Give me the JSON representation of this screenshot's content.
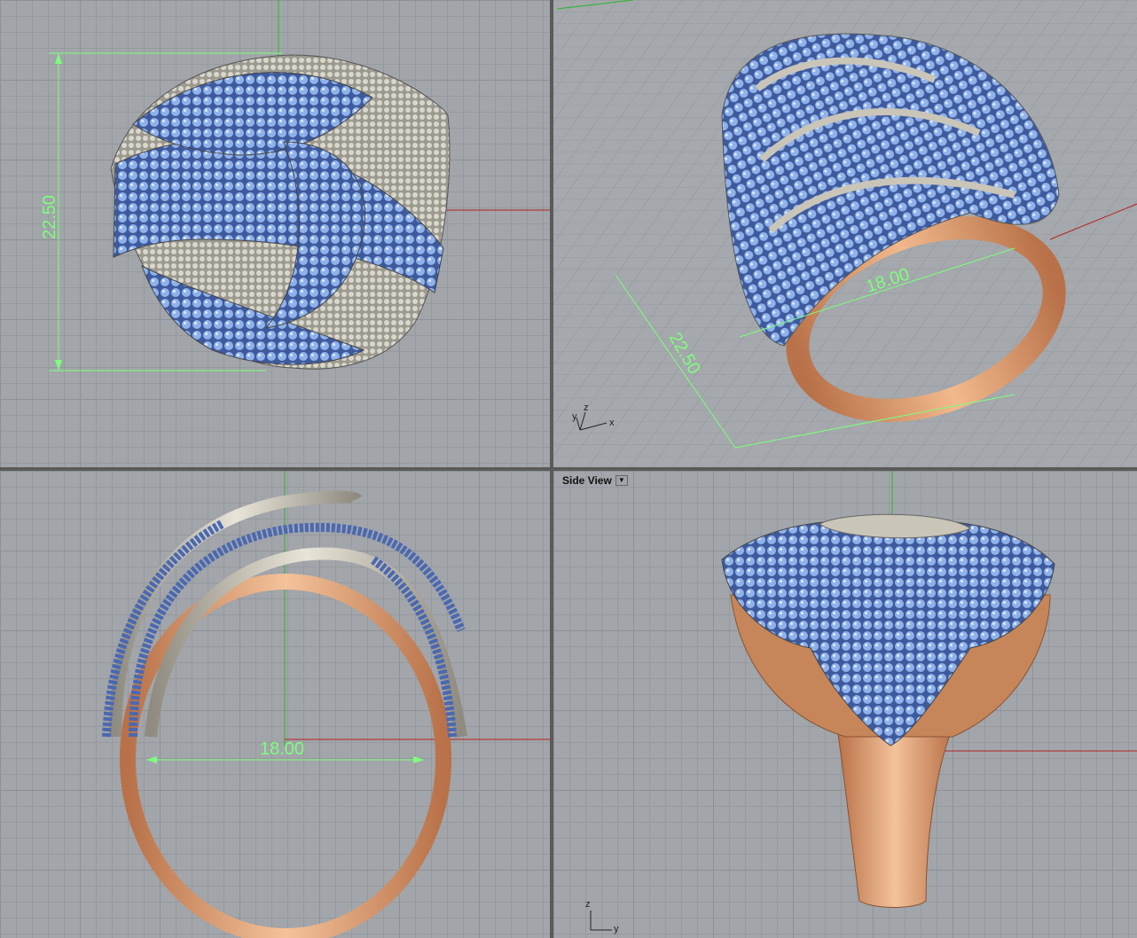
{
  "viewports": {
    "top": {
      "title": ""
    },
    "perspective": {
      "title": ""
    },
    "front": {
      "title": ""
    },
    "side": {
      "title": "Side View"
    }
  },
  "dimensions": {
    "height": "22.50",
    "diameter": "18.00"
  },
  "axes": {
    "x": "x",
    "y": "y",
    "z": "z"
  },
  "colors": {
    "grid_bg": "#a2a5a9",
    "dimension": "#7dff7d",
    "x_axis": "#b22222",
    "y_axis": "#2fb52f",
    "gold": "#d99b6c",
    "silver": "#c9c5b8",
    "stone": "#6f94d6"
  }
}
